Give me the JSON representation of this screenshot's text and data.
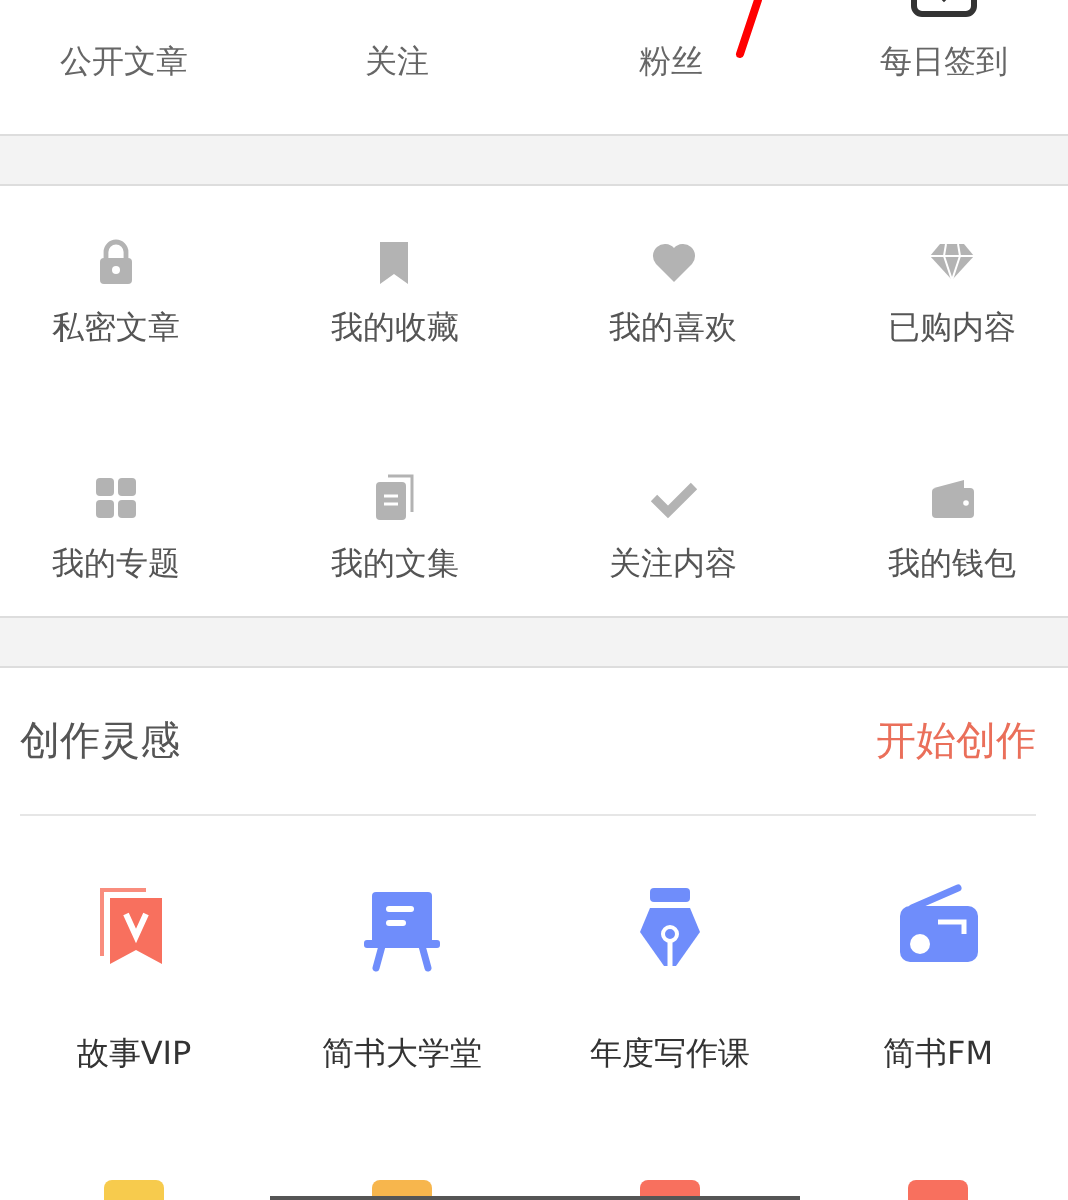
{
  "stats": [
    {
      "label": "公开文章",
      "kind": "count"
    },
    {
      "label": "关注",
      "kind": "count"
    },
    {
      "label": "粉丝",
      "kind": "count"
    },
    {
      "label": "每日签到",
      "kind": "checkin"
    }
  ],
  "annotation": {
    "kind": "stroke",
    "color": "#ff0000"
  },
  "menu": [
    {
      "label": "私密文章",
      "kind": "lock"
    },
    {
      "label": "我的收藏",
      "kind": "bookmark"
    },
    {
      "label": "我的喜欢",
      "kind": "heart"
    },
    {
      "label": "已购内容",
      "kind": "diamond"
    },
    {
      "label": "我的专题",
      "kind": "grid"
    },
    {
      "label": "我的文集",
      "kind": "docs"
    },
    {
      "label": "关注内容",
      "kind": "check"
    },
    {
      "label": "我的钱包",
      "kind": "wallet"
    }
  ],
  "inspiration": {
    "title": "创作灵感",
    "action": "开始创作",
    "tools": [
      {
        "label": "故事VIP",
        "kind": "vip"
      },
      {
        "label": "简书大学堂",
        "kind": "easel"
      },
      {
        "label": "年度写作课",
        "kind": "pen"
      },
      {
        "label": "简书FM",
        "kind": "radio"
      }
    ],
    "more_tools": [
      {
        "color": "#f7cb4d"
      },
      {
        "color": "#f7b64d"
      },
      {
        "color": "#f8705e"
      },
      {
        "color": "#f8705e"
      }
    ]
  }
}
